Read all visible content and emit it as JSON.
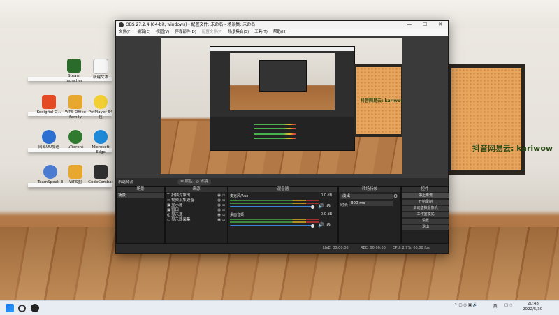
{
  "desktop": {
    "icons": [
      {
        "label": "Steam\nlauncher",
        "color": "#2a6a2a"
      },
      {
        "label": "新建文本",
        "color": "#ffffff"
      },
      {
        "label": "Kodigital G...",
        "color": "#e44a24"
      },
      {
        "label": "WPS\nOffice Family",
        "color": "#e8a830"
      },
      {
        "label": "PotPlayer 64\n位",
        "color": "#f2d035"
      },
      {
        "label": "网易UU加速",
        "color": "#2b6fd1"
      },
      {
        "label": "uTorrent",
        "color": "#2f7a2f"
      },
      {
        "label": "Microsoft Edge",
        "color": "#1f8ad8"
      },
      {
        "label": "TeamSpeak 3",
        "color": "#4a7bd0"
      },
      {
        "label": "WPS图",
        "color": "#e8a830"
      },
      {
        "label": "CodeCombat",
        "color": "#2f2f2f"
      }
    ],
    "board_text_1": "抖音网易云: kariwow",
    "board_text_2": "抖音网易云: kariwow"
  },
  "window": {
    "title": "OBS 27.2.4 (64-bit, windows) - 配置文件: 未命名 - 场景集: 未命名",
    "buttons": [
      "—",
      "☐",
      "✕"
    ],
    "menu": [
      "文件(F)",
      "编辑(E)",
      "视图(V)",
      "停靠部件(D)",
      "配置文件(P)",
      "场景集合(S)",
      "工具(T)",
      "帮助(H)"
    ]
  },
  "toolbar": {
    "scene_tag": "未选择源",
    "props_label": "⚙ 属性",
    "filters_label": "◎ 滤镜"
  },
  "docks": {
    "scenes": {
      "title": "场景",
      "items": [
        "场景"
      ]
    },
    "sources": {
      "title": "来源",
      "items": [
        {
          "icon": "T",
          "label": "扫描对象出"
        },
        {
          "icon": "▭",
          "label": "视频采集设备"
        },
        {
          "icon": "▣",
          "label": "显示器"
        },
        {
          "icon": "▣",
          "label": "窗口"
        },
        {
          "icon": "◐",
          "label": "显示源"
        },
        {
          "icon": "▭",
          "label": "显示器采集"
        }
      ]
    },
    "mixer": {
      "title": "混音器",
      "channels": [
        {
          "name": "麦克风/Aux",
          "db": "0.0 dB"
        },
        {
          "name": "桌面音频",
          "db": "0.0 dB"
        }
      ]
    },
    "transitions": {
      "title": "转场特效",
      "type": "淡出",
      "duration_label": "时长",
      "duration_value": "300 ms"
    },
    "controls": {
      "title": "控件",
      "buttons": [
        "停止推流",
        "开始录制",
        "启动虚拟摄像机",
        "工作室模式",
        "设置",
        "退出"
      ]
    }
  },
  "status": {
    "live": "LIVE: 00:00:00",
    "rec": "REC: 00:00:00",
    "cpu": "CPU: 2.9%, 60.00 fps"
  },
  "taskbar": {
    "time": "20:48",
    "date": "2022/5/30",
    "ime": "英"
  }
}
